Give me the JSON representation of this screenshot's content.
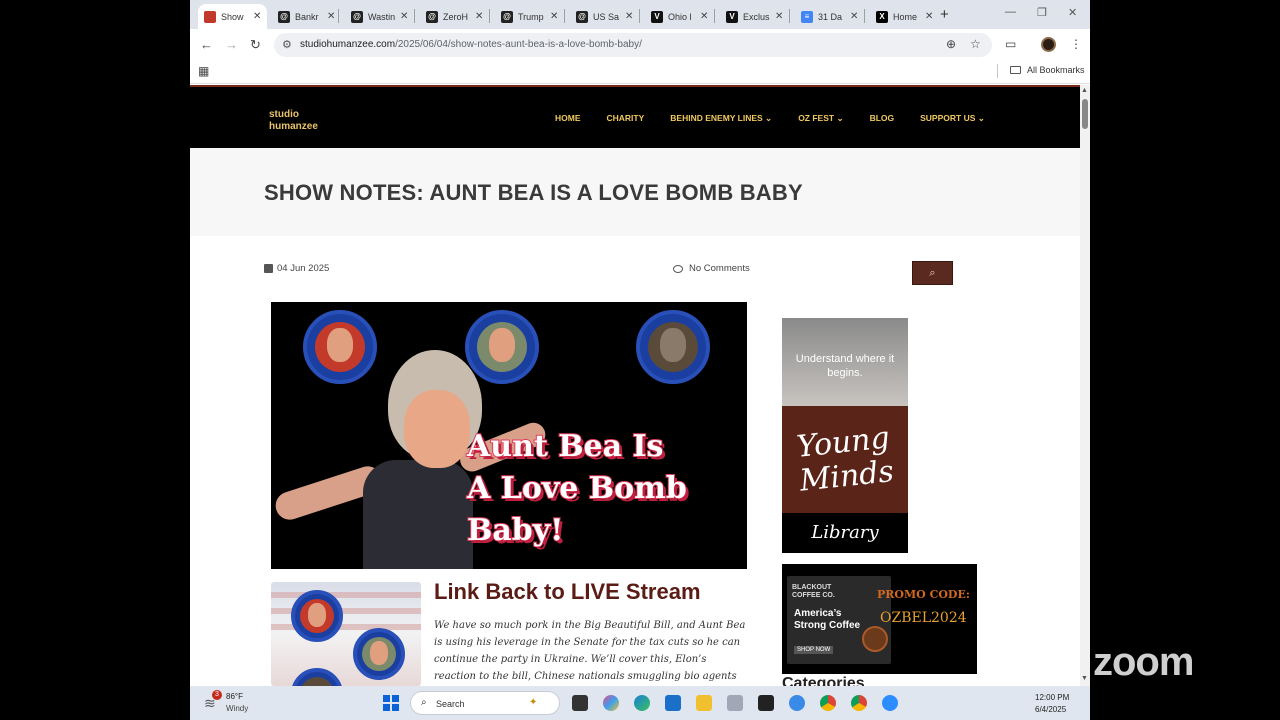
{
  "browser": {
    "tabs": [
      {
        "title": "Show",
        "favicon_color": "#c0392b",
        "active": true
      },
      {
        "title": "Bankr",
        "favicon_color": "#222222",
        "active": false
      },
      {
        "title": "Wastin",
        "favicon_color": "#222222",
        "active": false
      },
      {
        "title": "ZeroH",
        "favicon_color": "#222222",
        "active": false
      },
      {
        "title": "Trump",
        "favicon_color": "#222222",
        "active": false
      },
      {
        "title": "US Sa",
        "favicon_color": "#222222",
        "active": false
      },
      {
        "title": "Ohio l",
        "favicon_color": "#111111",
        "active": false
      },
      {
        "title": "Exclus",
        "favicon_color": "#111111",
        "active": false
      },
      {
        "title": "31 Da",
        "favicon_color": "#4285f4",
        "active": false
      },
      {
        "title": "Home",
        "favicon_color": "#000000",
        "active": false
      }
    ],
    "url_host": "studiohumanzee.com",
    "url_path": "/2025/06/04/show-notes-aunt-bea-is-a-love-bomb-baby/",
    "all_bookmarks": "All Bookmarks"
  },
  "site": {
    "logo_line1": "studio",
    "logo_line2": "humanzee",
    "nav": {
      "home": "HOME",
      "charity": "CHARITY",
      "behind": "BEHIND ENEMY LINES ⌄",
      "ozfest": "OZ FEST ⌄",
      "blog": "BLOG",
      "support": "SUPPORT US ⌄"
    }
  },
  "post": {
    "title": "SHOW NOTES: AUNT BEA IS A LOVE BOMB BABY",
    "date": "04 Jun 2025",
    "comments": "No Comments",
    "hero_text_1": "Aunt Bea Is",
    "hero_text_2": "A Love Bomb",
    "hero_text_3": "Baby!",
    "h2": "Link Back to LIVE Stream",
    "body": "We have so much pork in the Big Beautiful Bill, and Aunt Bea is using his leverage in the Senate for the tax cuts so he can continue the party in Ukraine. We’ll cover this, Elon’s reaction to the bill, Chinese nationals smuggling bio agents that"
  },
  "sidebar": {
    "ad1_tagline": "Understand where it begins.",
    "ad1_script": "Young Minds",
    "ad1_sub": "Library",
    "ad2_brand_1": "BLACKOUT",
    "ad2_brand_2": "COFFEE CO.",
    "ad2_slogan_1": "America’s",
    "ad2_slogan_2": "Strong Coffee",
    "ad2_shop": "SHOP NOW",
    "ad2_promo_label": "PROMO CODE:",
    "ad2_promo_code": "OZBEL2024",
    "categories": "Categories"
  },
  "overlay": {
    "zoom": "zoom"
  },
  "taskbar": {
    "weather_badge": "3",
    "weather_temp": "86°F",
    "weather_desc": "Windy",
    "search_placeholder": "Search",
    "time": "12:00 PM",
    "date": "6/4/2025"
  }
}
